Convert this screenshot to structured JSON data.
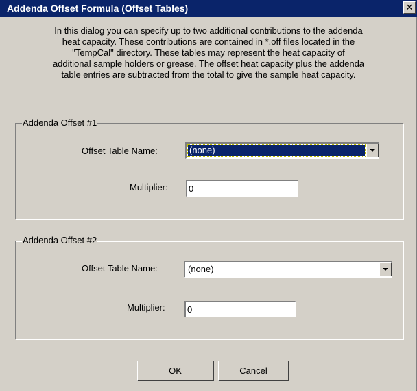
{
  "window": {
    "title": "Addenda Offset Formula (Offset Tables)",
    "close_glyph": "✕"
  },
  "description": {
    "lines": [
      "In this dialog you can specify up to two additional contributions to the addenda",
      "heat capacity.  These contributions are contained in *.off files located in the",
      "\"TempCal\" directory.  These tables may represent the heat capacity of",
      "additional sample holders or grease.  The offset heat capacity plus the addenda",
      "table entries are subtracted from the total to give the sample heat capacity."
    ]
  },
  "offset1": {
    "legend": "Addenda Offset #1",
    "table_label": "Offset Table Name:",
    "table_value": "(none)",
    "multiplier_label": "Multiplier:",
    "multiplier_value": "0"
  },
  "offset2": {
    "legend": "Addenda Offset #2",
    "table_label": "Offset Table Name:",
    "table_value": "(none)",
    "multiplier_label": "Multiplier:",
    "multiplier_value": "0"
  },
  "buttons": {
    "ok": "OK",
    "cancel": "Cancel"
  },
  "colors": {
    "titlebar": "#0a246a",
    "face": "#d4d0c8",
    "selection": "#0a246a"
  },
  "icons": {
    "close": "close-icon",
    "dropdown": "chevron-down-icon"
  }
}
